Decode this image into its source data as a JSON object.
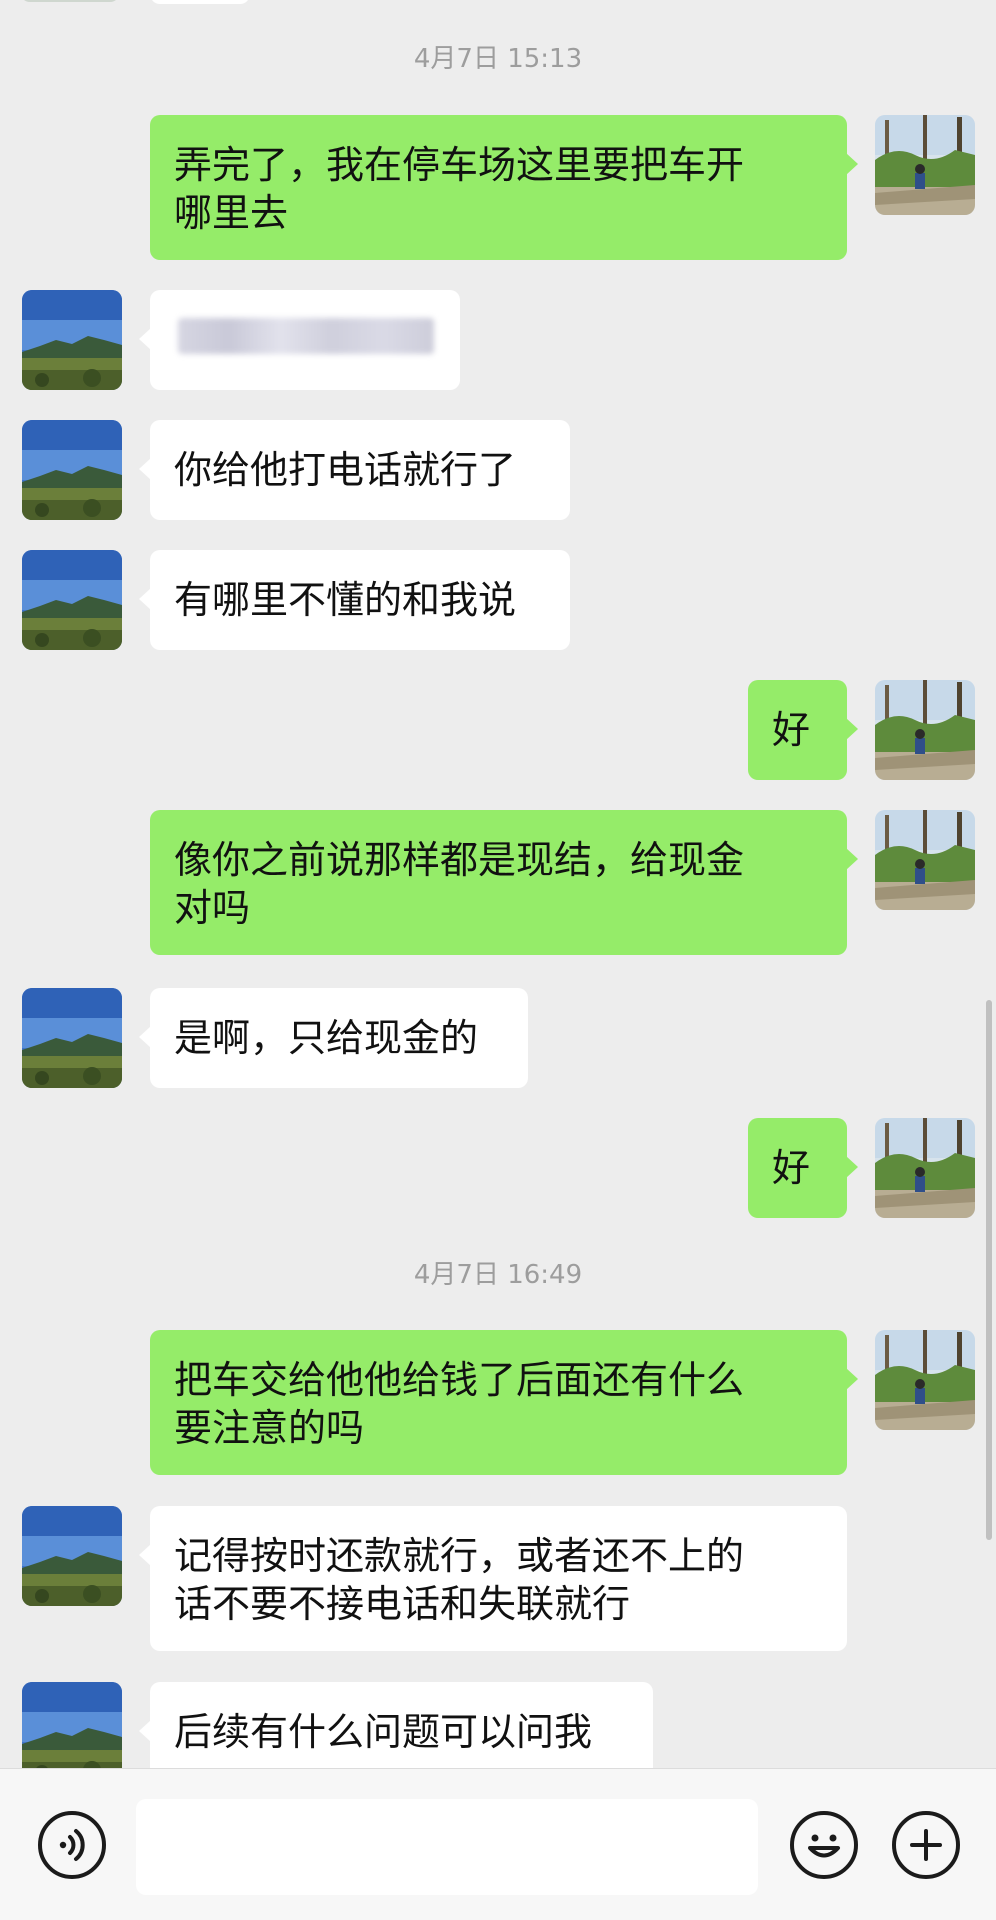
{
  "chat": {
    "timestamps": [
      "4月7日 15:13",
      "4月7日 16:49"
    ],
    "messages": [
      {
        "side": "out",
        "text": "弄完了，我在停车场这里要把车开\n哪里去"
      },
      {
        "side": "in",
        "text": ""
      },
      {
        "side": "in",
        "text": "你给他打电话就行了"
      },
      {
        "side": "in",
        "text": "有哪里不懂的和我说"
      },
      {
        "side": "out",
        "text": "好"
      },
      {
        "side": "out",
        "text": "像你之前说那样都是现结，给现金\n对吗"
      },
      {
        "side": "in",
        "text": "是啊，只给现金的"
      },
      {
        "side": "out",
        "text": "好"
      },
      {
        "side": "out",
        "text": "把车交给他他给钱了后面还有什么\n要注意的吗"
      },
      {
        "side": "in",
        "text": "记得按时还款就行，或者还不上的\n话不要不接电话和失联就行"
      },
      {
        "side": "in",
        "text": "后续有什么问题可以问我"
      }
    ]
  },
  "input_bar": {
    "voice_icon": "voice-icon",
    "emoji_icon": "emoji-icon",
    "plus_icon": "plus-icon",
    "text_value": ""
  },
  "colors": {
    "background": "#ededed",
    "outgoing_bubble": "#95ec69",
    "incoming_bubble": "#ffffff",
    "timestamp": "#9d9d9d"
  }
}
